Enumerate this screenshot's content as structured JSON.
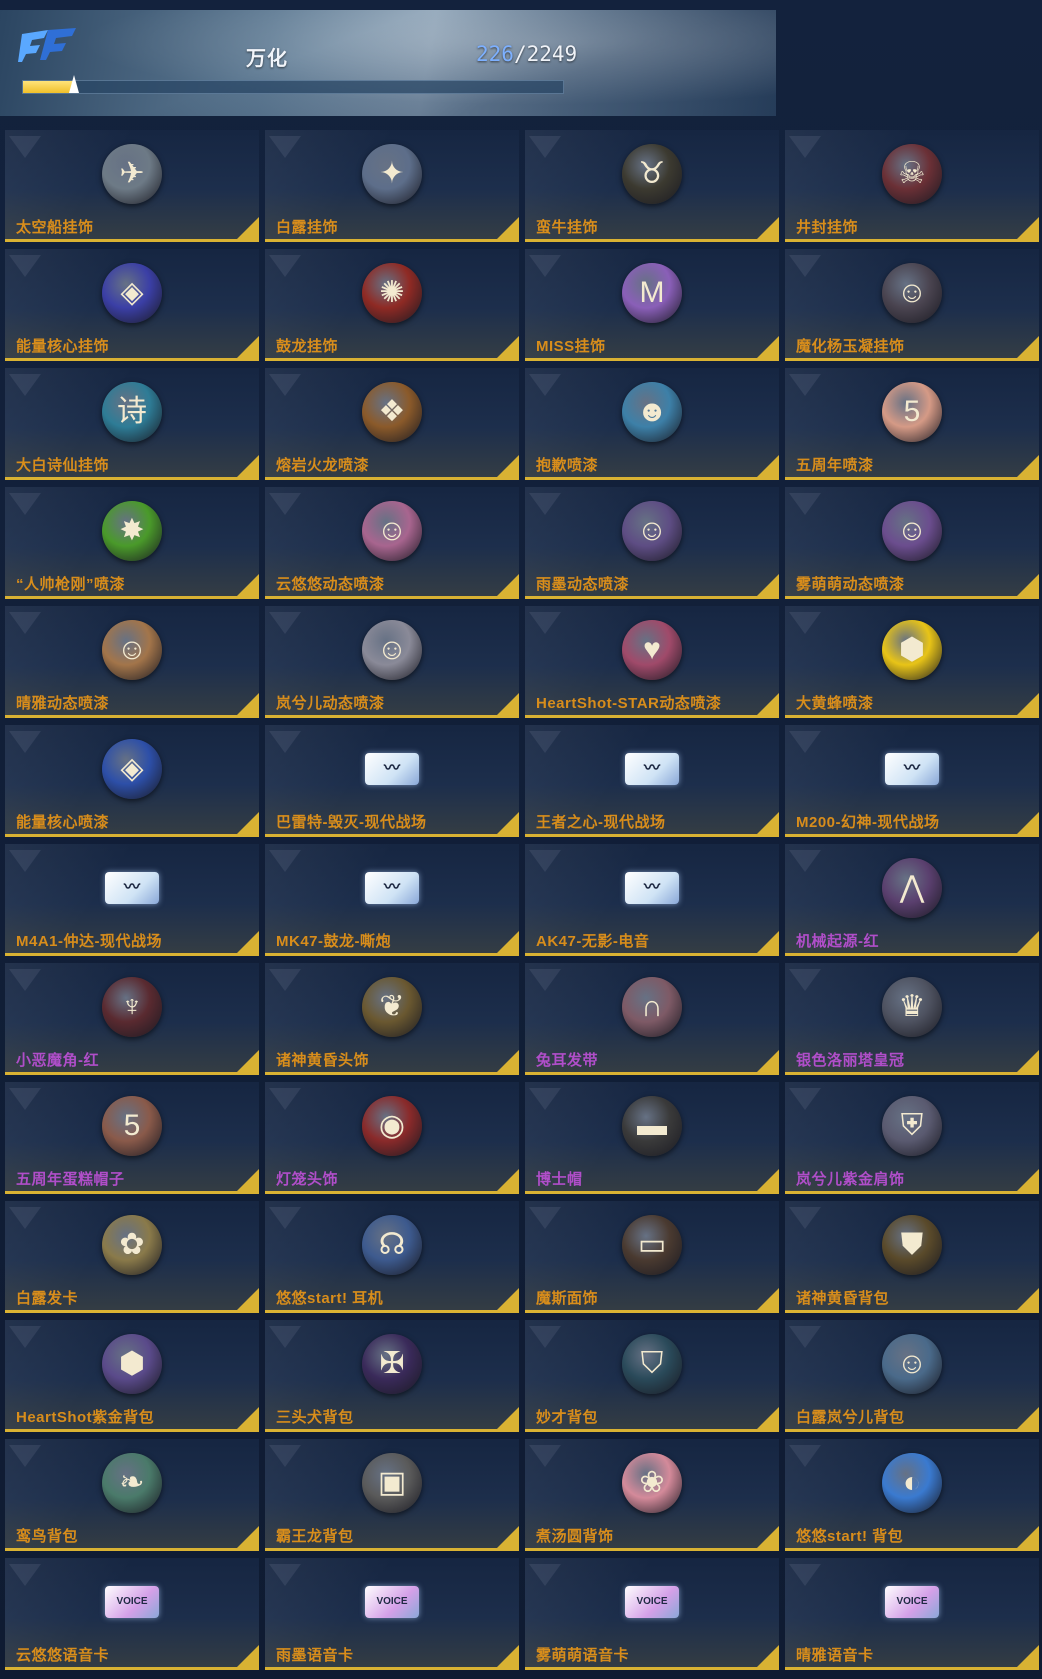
{
  "header": {
    "title": "万化",
    "count_current": "226",
    "count_separator": "/",
    "count_total": "2249",
    "progress_fraction": 0.094
  },
  "items": [
    {
      "label": "太空船挂饰",
      "color": "orange",
      "icon": "spaceship-badge-icon",
      "glyph": "✈",
      "bg": "#6d7a86"
    },
    {
      "label": "白露挂饰",
      "color": "orange",
      "icon": "fairy-figure-icon",
      "glyph": "✦",
      "bg": "#5d6e8a"
    },
    {
      "label": "蛮牛挂饰",
      "color": "orange",
      "icon": "bull-badge-icon",
      "glyph": "♉",
      "bg": "#3c3a30"
    },
    {
      "label": "井封挂饰",
      "color": "orange",
      "icon": "demon-mask-badge-icon",
      "glyph": "☠",
      "bg": "#6b3036"
    },
    {
      "label": "能量核心挂饰",
      "color": "orange",
      "icon": "energy-core-badge-icon",
      "glyph": "◈",
      "bg": "#3b3fa6"
    },
    {
      "label": "鼓龙挂饰",
      "color": "orange",
      "icon": "dragon-badge-icon",
      "glyph": "✺",
      "bg": "#8f2a24"
    },
    {
      "label": "MISS挂饰",
      "color": "orange",
      "icon": "miss-badge-icon",
      "glyph": "M",
      "bg": "#8a5fb8"
    },
    {
      "label": "魔化杨玉凝挂饰",
      "color": "orange",
      "icon": "opera-mask-badge-icon",
      "glyph": "☺",
      "bg": "#4a4450"
    },
    {
      "label": "大白诗仙挂饰",
      "color": "orange",
      "icon": "poem-crystal-badge-icon",
      "glyph": "诗",
      "bg": "#2e7c96"
    },
    {
      "label": "熔岩火龙喷漆",
      "color": "orange",
      "icon": "lava-dragon-spray-icon",
      "glyph": "❖",
      "bg": "#8b5a2a"
    },
    {
      "label": "抱歉喷漆",
      "color": "orange",
      "icon": "sorry-spray-icon",
      "glyph": "☻",
      "bg": "#3d80a8"
    },
    {
      "label": "五周年喷漆",
      "color": "orange",
      "icon": "fifth-anniversary-spray-icon",
      "glyph": "5",
      "bg": "#d59a86"
    },
    {
      "label": "“人帅枪刚”喷漆",
      "color": "orange",
      "icon": "green-splash-spray-icon",
      "glyph": "✸",
      "bg": "#4a9a2a"
    },
    {
      "label": "云悠悠动态喷漆",
      "color": "orange",
      "icon": "pink-girl-spray-icon",
      "glyph": "☺",
      "bg": "#a8658f"
    },
    {
      "label": "雨墨动态喷漆",
      "color": "orange",
      "icon": "purple-girl-spray-icon",
      "glyph": "☺",
      "bg": "#5e4d84"
    },
    {
      "label": "雾萌萌动态喷漆",
      "color": "orange",
      "icon": "twin-tail-girl-spray-icon",
      "glyph": "☺",
      "bg": "#6b4d8e"
    },
    {
      "label": "晴雅动态喷漆",
      "color": "orange",
      "icon": "bunny-girl-spray-icon",
      "glyph": "☺",
      "bg": "#a3754a"
    },
    {
      "label": "岚兮儿动态喷漆",
      "color": "orange",
      "icon": "silver-hair-girl-spray-icon",
      "glyph": "☺",
      "bg": "#8a8a98"
    },
    {
      "label": "HeartShot-STAR动态喷漆",
      "color": "orange",
      "icon": "heartshot-star-spray-icon",
      "glyph": "♥",
      "bg": "#a04a6a"
    },
    {
      "label": "大黄蜂喷漆",
      "color": "orange",
      "icon": "bumblebee-spray-icon",
      "glyph": "⬢",
      "bg": "#e8c417"
    },
    {
      "label": "能量核心喷漆",
      "color": "orange",
      "icon": "energy-core-spray-icon",
      "glyph": "◈",
      "bg": "#2d4fa8"
    },
    {
      "label": "巴雷特-毁灭-现代战场",
      "color": "orange",
      "icon": "weapon-card-icon",
      "glyph": "〰",
      "bg": "#cfe3f5",
      "card": true
    },
    {
      "label": "王者之心-现代战场",
      "color": "orange",
      "icon": "weapon-card-icon",
      "glyph": "〰",
      "bg": "#cfe3f5",
      "card": true
    },
    {
      "label": "M200-幻神-现代战场",
      "color": "orange",
      "icon": "weapon-card-icon",
      "glyph": "〰",
      "bg": "#cfe3f5",
      "card": true
    },
    {
      "label": "M4A1-仲达-现代战场",
      "color": "orange",
      "icon": "weapon-card-icon",
      "glyph": "〰",
      "bg": "#cfe3f5",
      "card": true
    },
    {
      "label": "MK47-鼓龙-嘶炮",
      "color": "orange",
      "icon": "weapon-card-icon",
      "glyph": "〰",
      "bg": "#cfe3f5",
      "card": true
    },
    {
      "label": "AK47-无影-电音",
      "color": "orange",
      "icon": "weapon-card-icon",
      "glyph": "〰",
      "bg": "#cfe3f5",
      "card": true
    },
    {
      "label": "机械起源-红",
      "color": "purple",
      "icon": "cat-ear-headband-icon",
      "glyph": "⋀",
      "bg": "#5a3f6e"
    },
    {
      "label": "小恶魔角-红",
      "color": "purple",
      "icon": "devil-horn-headband-icon",
      "glyph": "♆",
      "bg": "#5a2a30"
    },
    {
      "label": "诸神黄昏头饰",
      "color": "orange",
      "icon": "golden-wing-headpiece-icon",
      "glyph": "❦",
      "bg": "#6a5830"
    },
    {
      "label": "兔耳发带",
      "color": "purple",
      "icon": "bunny-ear-headband-icon",
      "glyph": "∩",
      "bg": "#7e5a66"
    },
    {
      "label": "银色洛丽塔皇冠",
      "color": "purple",
      "icon": "silver-crown-headband-icon",
      "glyph": "♛",
      "bg": "#4e5260"
    },
    {
      "label": "五周年蛋糕帽子",
      "color": "purple",
      "icon": "cake-hat-icon",
      "glyph": "5",
      "bg": "#8a5a4a"
    },
    {
      "label": "灯笼头饰",
      "color": "purple",
      "icon": "lantern-headpiece-icon",
      "glyph": "◉",
      "bg": "#8a2a2a"
    },
    {
      "label": "博士帽",
      "color": "purple",
      "icon": "graduation-cap-icon",
      "glyph": "▬",
      "bg": "#3a3a3a"
    },
    {
      "label": "岚兮儿紫金肩饰",
      "color": "purple",
      "icon": "purple-gold-shoulder-icon",
      "glyph": "⛨",
      "bg": "#5a5a70"
    },
    {
      "label": "白露发卡",
      "color": "orange",
      "icon": "ginkgo-hairpin-icon",
      "glyph": "✿",
      "bg": "#8a7a4a"
    },
    {
      "label": "悠悠start! 耳机",
      "color": "orange",
      "icon": "headphones-icon",
      "glyph": "☊",
      "bg": "#3d5a8e"
    },
    {
      "label": "魔斯面饰",
      "color": "orange",
      "icon": "mask-facepiece-icon",
      "glyph": "▭",
      "bg": "#4a3a30"
    },
    {
      "label": "诸神黄昏背包",
      "color": "orange",
      "icon": "golden-backpack-icon",
      "glyph": "⛊",
      "bg": "#5a4a2a"
    },
    {
      "label": "HeartShot紫金背包",
      "color": "orange",
      "icon": "purple-gold-backpack-icon",
      "glyph": "⬢",
      "bg": "#5a4a8a"
    },
    {
      "label": "三头犬背包",
      "color": "orange",
      "icon": "cerberus-backpack-icon",
      "glyph": "✠",
      "bg": "#3a2a5a"
    },
    {
      "label": "妙才背包",
      "color": "orange",
      "icon": "armored-backpack-icon",
      "glyph": "⛉",
      "bg": "#2a4a5a"
    },
    {
      "label": "白露岚兮儿背包",
      "color": "orange",
      "icon": "chibi-girl-backpack-icon",
      "glyph": "☺",
      "bg": "#4a6a8a"
    },
    {
      "label": "鸾鸟背包",
      "color": "orange",
      "icon": "phoenix-backpack-icon",
      "glyph": "❧",
      "bg": "#4a7a6a"
    },
    {
      "label": "霸王龙背包",
      "color": "orange",
      "icon": "trex-backpack-icon",
      "glyph": "▣",
      "bg": "#5a5a5a"
    },
    {
      "label": "煮汤圆背饰",
      "color": "orange",
      "icon": "rice-ball-backpack-icon",
      "glyph": "❀",
      "bg": "#d48a9a"
    },
    {
      "label": "悠悠start! 背包",
      "color": "orange",
      "icon": "blue-yellow-backpack-icon",
      "glyph": "◐",
      "bg": "#3a7ad0"
    },
    {
      "label": "云悠悠语音卡",
      "color": "orange",
      "icon": "voice-card-icon",
      "glyph": "VOICE",
      "bg": "#d4a0e8",
      "card": true
    },
    {
      "label": "雨墨语音卡",
      "color": "orange",
      "icon": "voice-card-icon",
      "glyph": "VOICE",
      "bg": "#d4a0e8",
      "card": true
    },
    {
      "label": "雾萌萌语音卡",
      "color": "orange",
      "icon": "voice-card-icon",
      "glyph": "VOICE",
      "bg": "#d4a0e8",
      "card": true
    },
    {
      "label": "晴雅语音卡",
      "color": "orange",
      "icon": "voice-card-icon",
      "glyph": "VOICE",
      "bg": "#d4a0e8",
      "card": true
    }
  ]
}
